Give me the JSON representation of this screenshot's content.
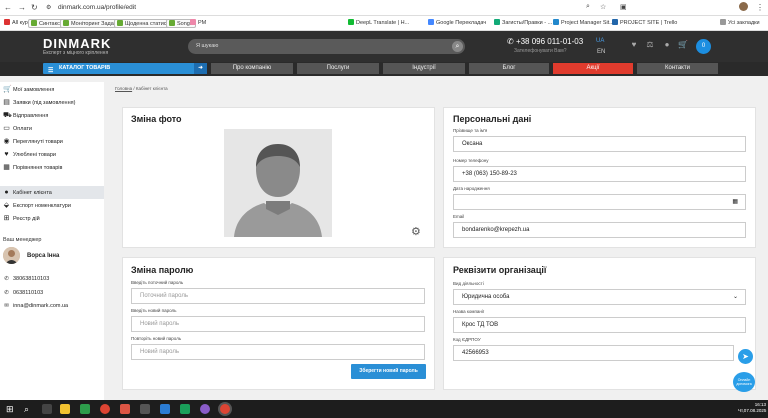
{
  "browser": {
    "url": "dinmark.com.ua/profile/edit",
    "bookmarks": [
      {
        "label": "All курс",
        "color": "#d33"
      },
      {
        "label": "Синтаксув",
        "color": "#6a3",
        "box": true
      },
      {
        "label": "Моніторинг Задачі",
        "color": "#6a3",
        "box": true
      },
      {
        "label": "Щоденна статистика",
        "color": "#6a3",
        "box": true
      },
      {
        "label": "Songs",
        "color": "#6a3",
        "box": true
      },
      {
        "label": "PM",
        "color": "#e8a"
      },
      {
        "label": "DeepL Translate | Н...",
        "color": "#1b3"
      },
      {
        "label": "Google Перекладач",
        "color": "#48f"
      },
      {
        "label": "Зaгиcты/Правки - ...",
        "color": "#1a7"
      },
      {
        "label": "Project Manager Sit...",
        "color": "#28c"
      },
      {
        "label": "PROJECT SITE | Trello",
        "color": "#26a"
      },
      {
        "label": "Усі закладки",
        "color": "#999"
      }
    ]
  },
  "header": {
    "logo": "DINMARK",
    "tagline": "Експерт з міцного кріплення",
    "search_placeholder": "Я шукаю",
    "phone": "+38 096 011-01-03",
    "callback": "Зателефонувати Вам?",
    "lang_active": "UA",
    "lang_other": "EN",
    "cart_count": "0"
  },
  "menu": {
    "catalog": "КАТАЛОГ ТОВАРІВ",
    "tabs": [
      "Про компанію",
      "Послуги",
      "Індустрії",
      "Блог",
      "Акції",
      "Контакти"
    ]
  },
  "breadcrumb": {
    "home": "Головна",
    "current": "Кабінет клієнта"
  },
  "sidebar": {
    "items": [
      {
        "label": "Мої замовлення",
        "icon": "cart-icon",
        "glyph": "🛒"
      },
      {
        "label": "Заявки (під замовлення)",
        "icon": "file-icon",
        "glyph": "▤"
      },
      {
        "label": "Відправлення",
        "icon": "truck-icon",
        "glyph": "⛟"
      },
      {
        "label": "Оплати",
        "icon": "card-icon",
        "glyph": "▭"
      },
      {
        "label": "Переглянуті товари",
        "icon": "eye-icon",
        "glyph": "◉"
      },
      {
        "label": "Улюблені товари",
        "icon": "heart-icon",
        "glyph": "♥"
      },
      {
        "label": "Порівняння товарів",
        "icon": "compare-icon",
        "glyph": "▦"
      },
      {
        "label": "Кабінет клієнта",
        "icon": "user-icon",
        "glyph": "●",
        "active": true
      },
      {
        "label": "Експорт номенклатури",
        "icon": "export-icon",
        "glyph": "⬙"
      },
      {
        "label": "Реєстр дій",
        "icon": "register-icon",
        "glyph": "⊞"
      }
    ],
    "manager_heading": "Ваш менеджер",
    "manager_name": "Ворса Інна",
    "contacts": [
      {
        "text": "380638110103",
        "icon": "phone-icon",
        "glyph": "✆"
      },
      {
        "text": "0638110103",
        "icon": "phone-icon",
        "glyph": "✆"
      },
      {
        "text": "inna@dinmark.com.ua",
        "icon": "mail-icon",
        "glyph": "✉"
      }
    ]
  },
  "photo_card": {
    "title": "Зміна фото"
  },
  "personal_card": {
    "title": "Персональні дані",
    "fields": [
      {
        "label": "Прізвище та ім'я",
        "value": "Оксана"
      },
      {
        "label": "Номер телефону",
        "value": "+38 (063) 150-89-23"
      },
      {
        "label": "Дата народження",
        "value": ""
      },
      {
        "label": "Email",
        "value": "bondarenko@krepezh.ua"
      }
    ]
  },
  "password_card": {
    "title": "Зміна паролю",
    "fields": [
      {
        "label": "Введіть поточний пароль",
        "placeholder": "Поточний пароль"
      },
      {
        "label": "Введіть новий пароль",
        "placeholder": "Новий пароль"
      },
      {
        "label": "Повторіть новий пароль",
        "placeholder": "Новий пароль"
      }
    ],
    "save": "Зберегти новий пароль"
  },
  "org_card": {
    "title": "Реквізити організації",
    "fields": [
      {
        "label": "Вид діяльності",
        "value": "Юридична особа"
      },
      {
        "label": "Назва компанії",
        "value": "Крос ТД ТОВ"
      },
      {
        "label": "Код ЄДРПОУ",
        "value": "42566953"
      }
    ]
  },
  "help_widget": "Онлайн допомога",
  "taskbar": {
    "time": "16:13",
    "date": "Чт,07.08.2025"
  }
}
